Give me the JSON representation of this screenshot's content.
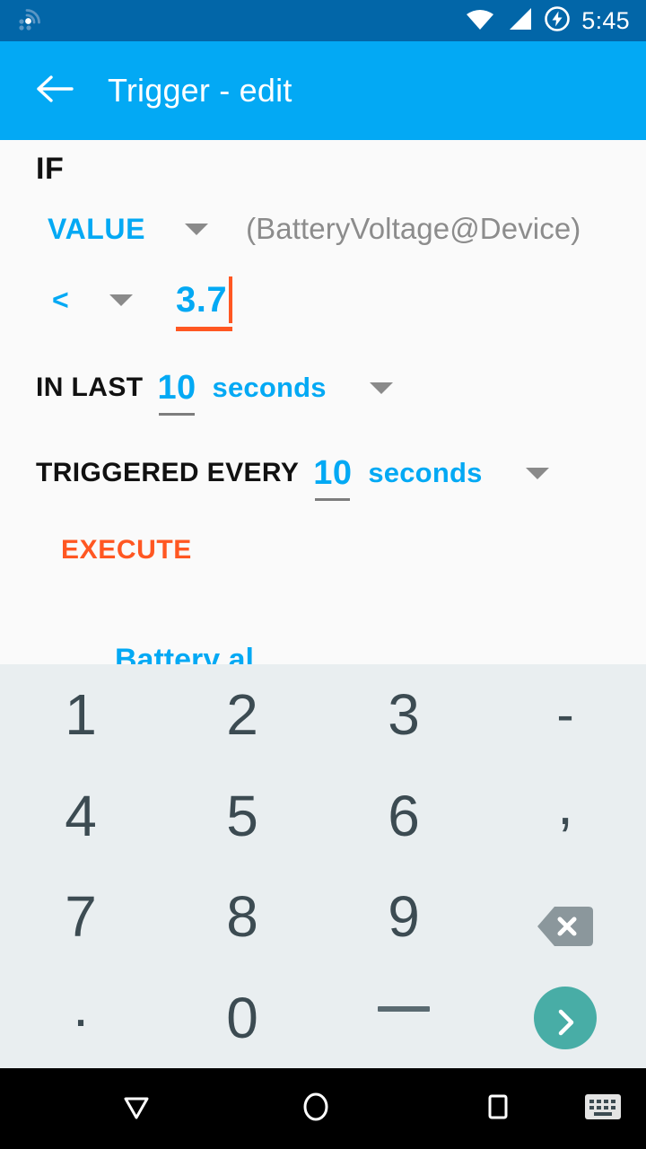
{
  "status_bar": {
    "background": "#0266a8",
    "notification_icon": "cast-wireless-icon",
    "icons": [
      "wifi-icon",
      "cellular-signal-icon",
      "battery-charging-icon"
    ],
    "time": "5:45"
  },
  "app_bar": {
    "background": "#03a9f4",
    "back_icon": "arrow-left-icon",
    "title": "Trigger - edit"
  },
  "trigger_form": {
    "if_label": "IF",
    "value_row": {
      "source_type": "VALUE",
      "source_name": "(BatteryVoltage@Device)",
      "dropdown_icon": "chevron-down-icon"
    },
    "compare_row": {
      "operator": "<",
      "dropdown_icon": "chevron-down-icon",
      "threshold": "3.7",
      "cursor_color": "#ff5722",
      "underline_color": "#ff5722"
    },
    "in_last_row": {
      "label": "IN LAST",
      "amount": "10",
      "unit": "seconds",
      "dropdown_icon": "chevron-down-icon"
    },
    "triggered_every_row": {
      "label": "TRIGGERED EVERY",
      "amount": "10",
      "unit": "seconds",
      "dropdown_icon": "chevron-down-icon"
    },
    "execute_label": "EXECUTE",
    "action_text": "Battery al",
    "accent_color": "#03a9f4",
    "execute_color": "#ff5722"
  },
  "keyboard": {
    "background": "#e9eef0",
    "key_color": "#3c4b52",
    "keys": [
      {
        "name": "key-1",
        "label": "1"
      },
      {
        "name": "key-2",
        "label": "2"
      },
      {
        "name": "key-3",
        "label": "3"
      },
      {
        "name": "key-dash",
        "label": "-"
      },
      {
        "name": "key-4",
        "label": "4"
      },
      {
        "name": "key-5",
        "label": "5"
      },
      {
        "name": "key-6",
        "label": "6"
      },
      {
        "name": "key-comma",
        "label": ","
      },
      {
        "name": "key-7",
        "label": "7"
      },
      {
        "name": "key-8",
        "label": "8"
      },
      {
        "name": "key-9",
        "label": "9"
      },
      {
        "name": "key-backspace",
        "label": "backspace-icon"
      },
      {
        "name": "key-period",
        "label": "."
      },
      {
        "name": "key-0",
        "label": "0"
      },
      {
        "name": "key-underscore",
        "label": "_"
      },
      {
        "name": "key-enter",
        "label": "chevron-right-icon"
      }
    ],
    "enter_button_color": "#48ada6",
    "backspace_color": "#8b979c"
  },
  "nav_bar": {
    "background": "#000000",
    "back_icon": "triangle-down-back-icon",
    "home_icon": "circle-home-icon",
    "recents_icon": "square-recents-icon",
    "keyboard_icon": "keyboard-indicator-icon"
  }
}
